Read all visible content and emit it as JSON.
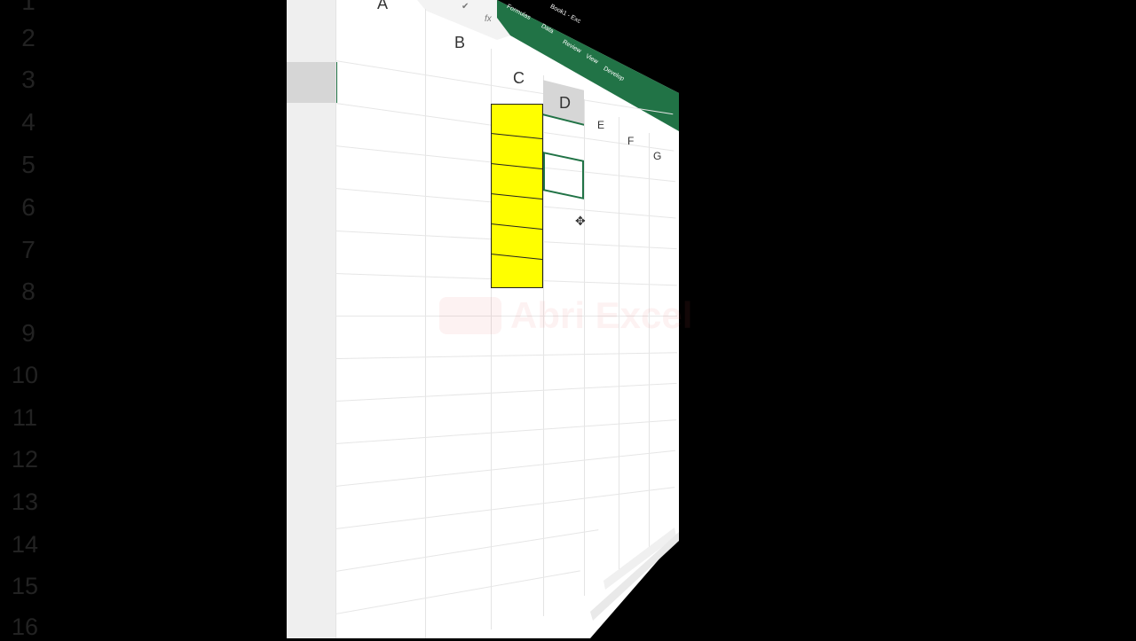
{
  "app": {
    "name": "Excel",
    "accent_color": "#217346"
  },
  "ribbon": {
    "title_fragment": "Book1 - Exc",
    "tabs": [
      "Formulas",
      "Data",
      "Review",
      "View",
      "Develop"
    ]
  },
  "formula_bar": {
    "confirm_icon": "check-icon",
    "function_label": "fx"
  },
  "columns": [
    "A",
    "B",
    "C",
    "D",
    "E",
    "F",
    "G"
  ],
  "rows": [
    "1",
    "2",
    "3",
    "4",
    "5",
    "6",
    "7",
    "8",
    "9",
    "10",
    "11",
    "12",
    "13",
    "14",
    "15",
    "16"
  ],
  "selection": {
    "active_cell": "D5",
    "highlighted_row": "3",
    "highlighted_col": "D"
  },
  "yellow_range": {
    "range": "C4:C8",
    "fill_color": "#ffff00",
    "cells": 6
  },
  "watermark": {
    "text": "Abri Excel"
  },
  "pointer": {
    "icon": "move-cursor-icon",
    "glyph": "✥"
  }
}
